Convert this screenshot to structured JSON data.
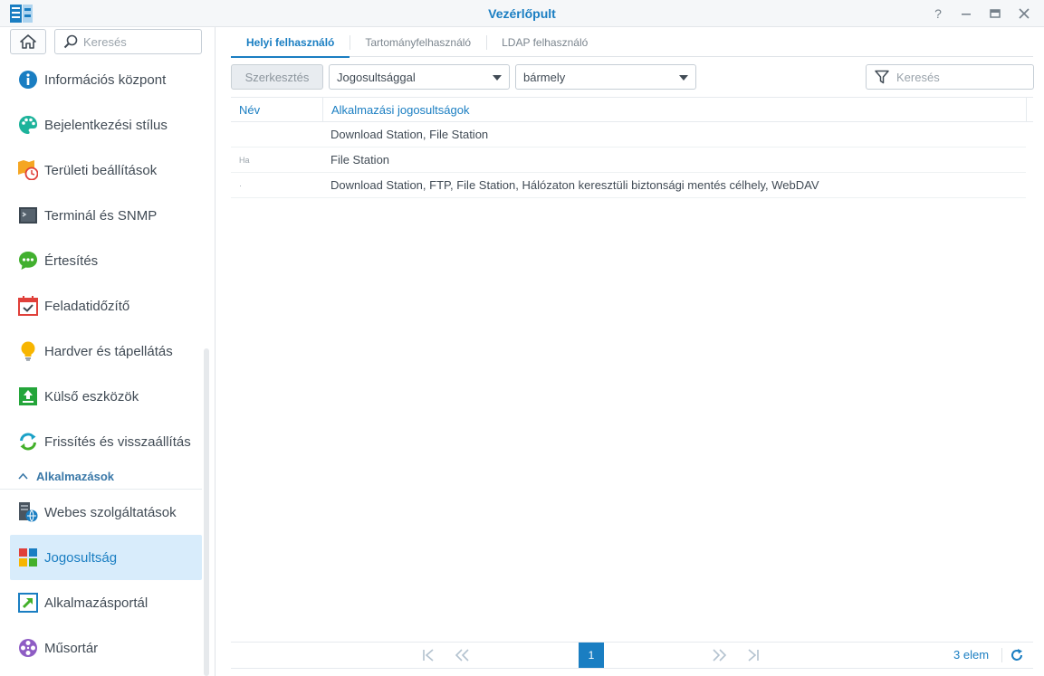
{
  "window": {
    "title": "Vezérlőpult",
    "controls": {
      "help": "?",
      "minimize": "—",
      "maximize": "▭",
      "close": "✕"
    }
  },
  "sidebar": {
    "search_placeholder": "Keresés",
    "items": [
      {
        "label": "Információs központ",
        "icon": "info-icon"
      },
      {
        "label": "Bejelentkezési stílus",
        "icon": "palette-icon"
      },
      {
        "label": "Területi beállítások",
        "icon": "regional-clock-icon"
      },
      {
        "label": "Terminál és SNMP",
        "icon": "terminal-icon"
      },
      {
        "label": "Értesítés",
        "icon": "chat-bubble-icon"
      },
      {
        "label": "Feladatidőzítő",
        "icon": "calendar-check-icon"
      },
      {
        "label": "Hardver és tápellátás",
        "icon": "lightbulb-icon"
      },
      {
        "label": "Külső eszközök",
        "icon": "upload-icon"
      },
      {
        "label": "Frissítés és visszaállítás",
        "icon": "refresh-icon"
      }
    ],
    "section": {
      "label": "Alkalmazások"
    },
    "app_items": [
      {
        "label": "Webes szolgáltatások",
        "icon": "web-server-icon"
      },
      {
        "label": "Jogosultság",
        "icon": "privileges-icon",
        "active": true
      },
      {
        "label": "Alkalmazásportál",
        "icon": "app-portal-icon"
      },
      {
        "label": "Műsortár",
        "icon": "film-reel-icon"
      }
    ]
  },
  "main": {
    "tabs": [
      {
        "label": "Helyi felhasználó",
        "active": true
      },
      {
        "label": "Tartományfelhasználó"
      },
      {
        "label": "LDAP felhasználó"
      }
    ],
    "toolbar": {
      "edit_label": "Szerkesztés",
      "filter_type": "Jogosultsággal",
      "filter_value": "bármely",
      "search_placeholder": "Keresés"
    },
    "table": {
      "columns": [
        "Név",
        "Alkalmazási jogosultságok"
      ],
      "rows": [
        {
          "name": "",
          "perms": "Download Station, File Station"
        },
        {
          "name": "Ha",
          "perms": "File Station"
        },
        {
          "name": "·",
          "perms": "Download Station, FTP, File Station, Hálózaton keresztüli biztonsági mentés célhely, WebDAV"
        }
      ]
    },
    "pagination": {
      "current_page": "1",
      "count_label": "3 elem"
    }
  },
  "colors": {
    "accent": "#1a7ec2",
    "active_bg": "#d8ecfb"
  }
}
